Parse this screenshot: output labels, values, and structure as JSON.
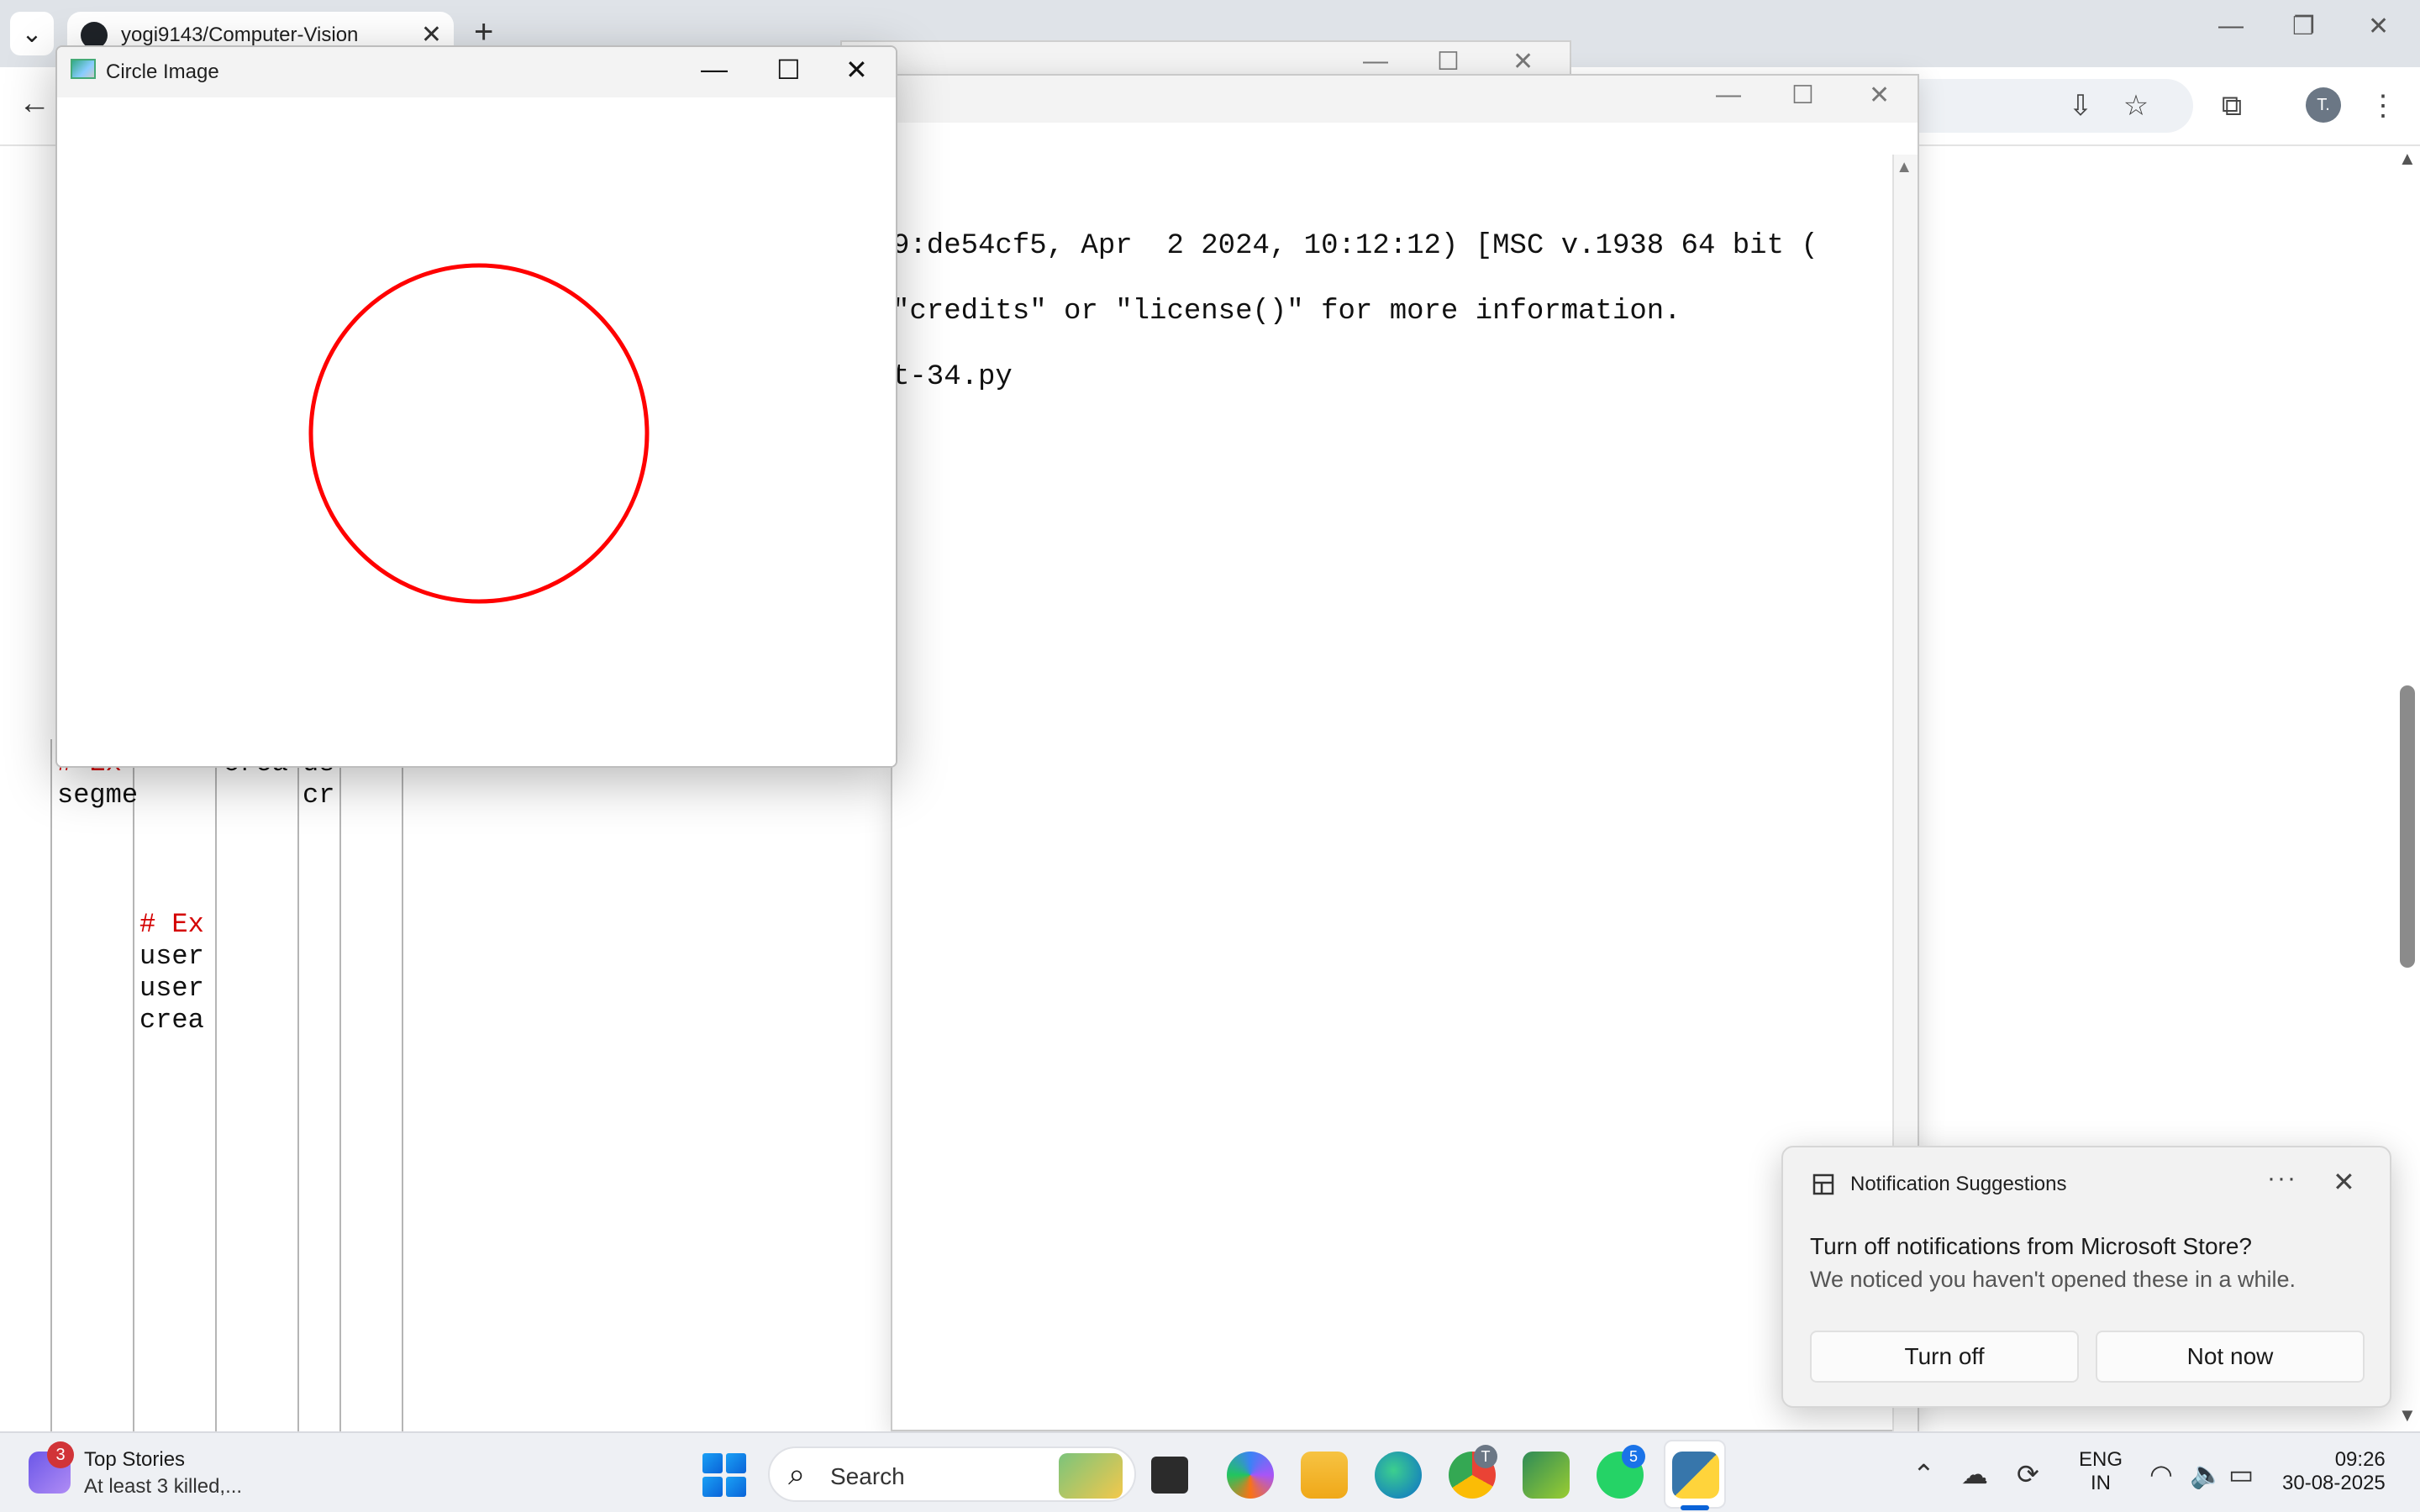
{
  "browser": {
    "tab_title": "yogi9143/Computer-Vision",
    "tab_close": "✕",
    "new_tab": "+",
    "tab_search": "⌄",
    "back": "←",
    "window_controls": {
      "minimize": "—",
      "restore": "❐",
      "close": "✕"
    },
    "profile_initial": "T."
  },
  "shell": {
    "lines": [
      "9:de54cf5, Apr  2 2024, 10:12:12) [MSC v.1938 64 bit (",
      "\"credits\" or \"license()\" for more information.",
      "t-34.py"
    ],
    "controls": {
      "minimize": "—",
      "maximize": "☐",
      "close": "✕"
    }
  },
  "editor_fragments": {
    "pane1": [
      "# Ex",
      "segme"
    ],
    "pane2": [
      "crea"
    ],
    "pane3": [
      "us",
      "cr"
    ],
    "pane4": [
      "# Ex",
      "user",
      "user",
      "crea"
    ]
  },
  "cv_window": {
    "title": "Circle Image",
    "controls": {
      "minimize": "—",
      "maximize": "☐",
      "close": "✕"
    },
    "circle_color": "#ff0000"
  },
  "toast": {
    "app_name": "Notification Suggestions",
    "more": "···",
    "close": "✕",
    "heading": "Turn off notifications from Microsoft Store?",
    "body": "We noticed you haven't opened these in a while.",
    "primary_button": "Turn off",
    "secondary_button": "Not now"
  },
  "taskbar": {
    "news_badge": "3",
    "news_title": "Top Stories",
    "news_subtitle": "At least 3 killed,...",
    "search_placeholder": "Search",
    "whatsapp_badge": "5",
    "chrome_badge": "T",
    "language_line1": "ENG",
    "language_line2": "IN",
    "time": "09:26",
    "date": "30-08-2025"
  }
}
